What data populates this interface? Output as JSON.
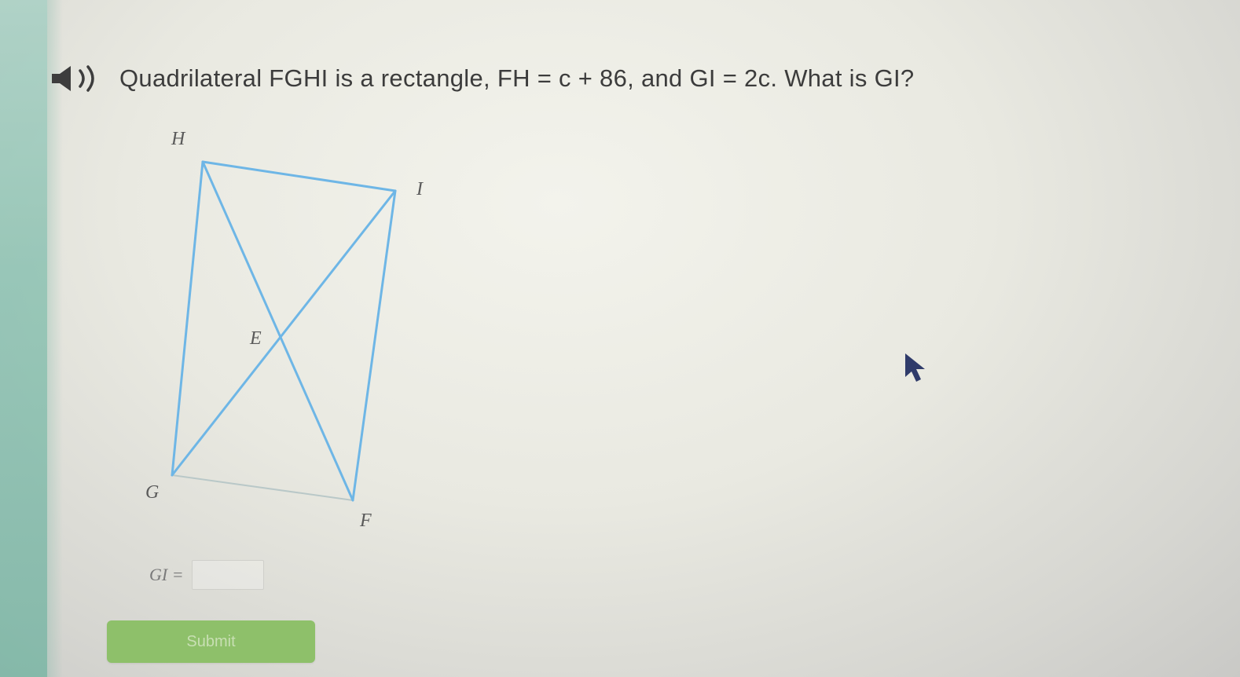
{
  "question": {
    "audio_icon": "speaker-icon",
    "text": "Quadrilateral FGHI is a rectangle, FH = c + 86, and GI = 2c. What is GI?"
  },
  "figure": {
    "vertices": {
      "H": "H",
      "I": "I",
      "E": "E",
      "G": "G",
      "F": "F"
    },
    "line_color": "#6eb6e6"
  },
  "answer": {
    "label": "GI =",
    "value": ""
  },
  "submit": {
    "label": "Submit",
    "color": "#8ec06a"
  },
  "cursor_icon": "mouse-pointer-icon"
}
